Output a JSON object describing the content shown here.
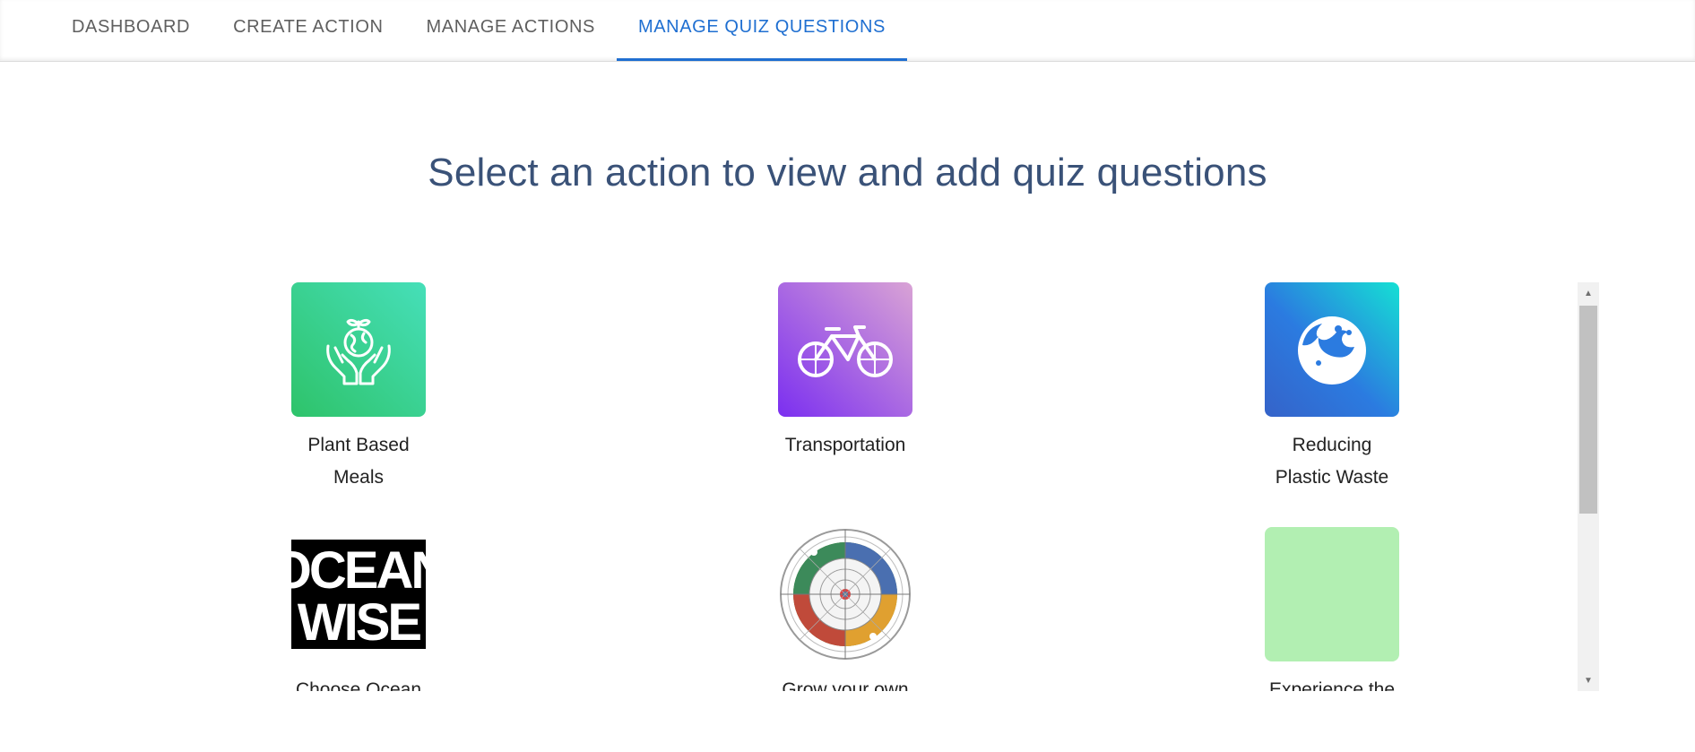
{
  "nav": {
    "tabs": [
      {
        "label": "DASHBOARD",
        "active": false
      },
      {
        "label": "CREATE ACTION",
        "active": false
      },
      {
        "label": "MANAGE ACTIONS",
        "active": false
      },
      {
        "label": "MANAGE QUIZ QUESTIONS",
        "active": true
      }
    ]
  },
  "main": {
    "heading": "Select an action to view and add quiz questions"
  },
  "actions": [
    {
      "label_line1": "Plant Based",
      "label_line2": "Meals",
      "icon": "hands-globe-icon",
      "colors": [
        "#2ec36a",
        "#46dfb9"
      ]
    },
    {
      "label_line1": "Transportation",
      "label_line2": "",
      "icon": "bicycle-icon",
      "colors": [
        "#7b2ff0",
        "#d9a3d5"
      ]
    },
    {
      "label_line1": "Reducing",
      "label_line2": "Plastic Waste",
      "icon": "ocean-wave-icon",
      "colors": [
        "#3563c9",
        "#15e0d4"
      ]
    },
    {
      "label_line1": "Choose Ocean",
      "label_line2": "",
      "icon": "ocean-wise-logo"
    },
    {
      "label_line1": "Grow your own",
      "label_line2": "",
      "icon": "garden-wheel-icon"
    },
    {
      "label_line1": "Experience the",
      "label_line2": "",
      "icon": "plain-green-tile",
      "colors": [
        "#b2efb2"
      ]
    }
  ],
  "logos": {
    "ocean_wise_line1": "OCEAN",
    "ocean_wise_line2": "WISE"
  }
}
